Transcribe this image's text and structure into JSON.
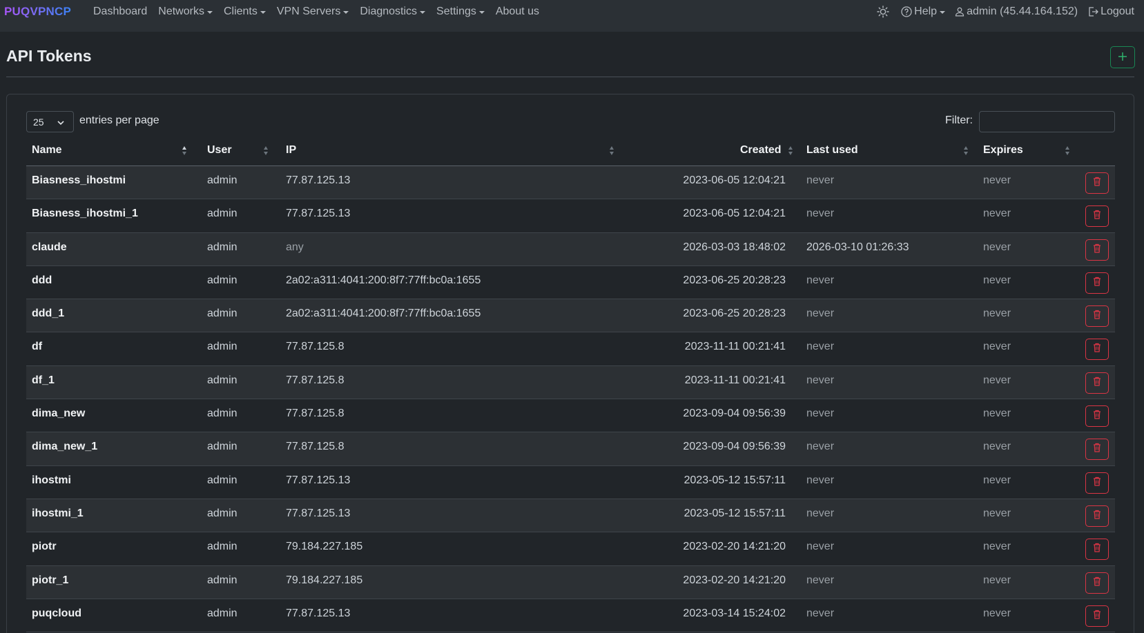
{
  "navbar": {
    "brand": "PUQVPNCP",
    "menu": [
      {
        "label": "Dashboard",
        "dropdown": false
      },
      {
        "label": "Networks",
        "dropdown": true
      },
      {
        "label": "Clients",
        "dropdown": true
      },
      {
        "label": "VPN Servers",
        "dropdown": true
      },
      {
        "label": "Diagnostics",
        "dropdown": true
      },
      {
        "label": "Settings",
        "dropdown": true
      },
      {
        "label": "About us",
        "dropdown": false
      }
    ],
    "help_label": "Help",
    "user_label": "admin (45.44.164.152)",
    "logout_label": "Logout"
  },
  "page": {
    "title": "API Tokens",
    "add_button_icon": "plus-icon"
  },
  "table_controls": {
    "page_length": "25",
    "page_length_label": "entries per page",
    "filter_label": "Filter:",
    "filter_value": ""
  },
  "table": {
    "columns": [
      "Name",
      "User",
      "IP",
      "Created",
      "Last used",
      "Expires"
    ],
    "rows": [
      {
        "name": "Biasness_ihostmi",
        "user": "admin",
        "ip": "77.87.125.13",
        "created": "2023-06-05 12:04:21",
        "last_used": "never",
        "expires": "never"
      },
      {
        "name": "Biasness_ihostmi_1",
        "user": "admin",
        "ip": "77.87.125.13",
        "created": "2023-06-05 12:04:21",
        "last_used": "never",
        "expires": "never"
      },
      {
        "name": "claude",
        "user": "admin",
        "ip": "any",
        "created": "2026-03-03 18:48:02",
        "last_used": "2026-03-10 01:26:33",
        "expires": "never"
      },
      {
        "name": "ddd",
        "user": "admin",
        "ip": "2a02:a311:4041:200:8f7:77ff:bc0a:1655",
        "created": "2023-06-25 20:28:23",
        "last_used": "never",
        "expires": "never"
      },
      {
        "name": "ddd_1",
        "user": "admin",
        "ip": "2a02:a311:4041:200:8f7:77ff:bc0a:1655",
        "created": "2023-06-25 20:28:23",
        "last_used": "never",
        "expires": "never"
      },
      {
        "name": "df",
        "user": "admin",
        "ip": "77.87.125.8",
        "created": "2023-11-11 00:21:41",
        "last_used": "never",
        "expires": "never"
      },
      {
        "name": "df_1",
        "user": "admin",
        "ip": "77.87.125.8",
        "created": "2023-11-11 00:21:41",
        "last_used": "never",
        "expires": "never"
      },
      {
        "name": "dima_new",
        "user": "admin",
        "ip": "77.87.125.8",
        "created": "2023-09-04 09:56:39",
        "last_used": "never",
        "expires": "never"
      },
      {
        "name": "dima_new_1",
        "user": "admin",
        "ip": "77.87.125.8",
        "created": "2023-09-04 09:56:39",
        "last_used": "never",
        "expires": "never"
      },
      {
        "name": "ihostmi",
        "user": "admin",
        "ip": "77.87.125.13",
        "created": "2023-05-12 15:57:11",
        "last_used": "never",
        "expires": "never"
      },
      {
        "name": "ihostmi_1",
        "user": "admin",
        "ip": "77.87.125.13",
        "created": "2023-05-12 15:57:11",
        "last_used": "never",
        "expires": "never"
      },
      {
        "name": "piotr",
        "user": "admin",
        "ip": "79.184.227.185",
        "created": "2023-02-20 14:21:20",
        "last_used": "never",
        "expires": "never"
      },
      {
        "name": "piotr_1",
        "user": "admin",
        "ip": "79.184.227.185",
        "created": "2023-02-20 14:21:20",
        "last_used": "never",
        "expires": "never"
      },
      {
        "name": "puqcloud",
        "user": "admin",
        "ip": "77.87.125.13",
        "created": "2023-03-14 15:24:02",
        "last_used": "never",
        "expires": "never"
      }
    ]
  },
  "colors": {
    "background": "#212529",
    "navbar": "#2b3035",
    "success": "#198754",
    "danger": "#dc3545",
    "brand_start": "#a855f7",
    "brand_end": "#3b82f6"
  }
}
